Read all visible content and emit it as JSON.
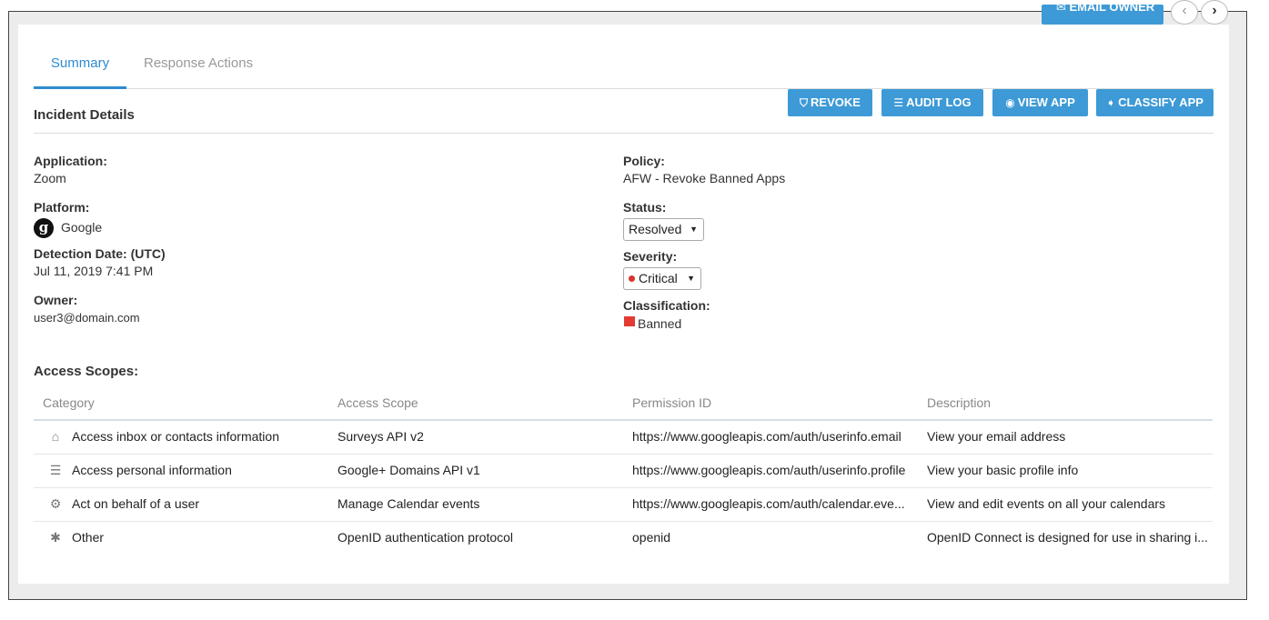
{
  "topbar": {
    "email_owner_label": "EMAIL OWNER",
    "prev_glyph": "‹",
    "next_glyph": "›"
  },
  "tabs": [
    {
      "label": "Summary",
      "active": true
    },
    {
      "label": "Response Actions",
      "active": false
    }
  ],
  "header": {
    "title": "Incident Details",
    "actions": {
      "revoke": {
        "label": "REVOKE",
        "icon": "shield-icon"
      },
      "audit_log": {
        "label": "AUDIT LOG",
        "icon": "list-icon"
      },
      "view_app": {
        "label": "VIEW APP",
        "icon": "eye-icon"
      },
      "classify_app": {
        "label": "CLASSIFY APP",
        "icon": "tag-icon"
      }
    }
  },
  "details": {
    "application_label": "Application:",
    "application_value": "Zoom",
    "platform_label": "Platform:",
    "platform_value": "Google",
    "platform_icon_glyph": "g",
    "detection_label": "Detection Date: (UTC)",
    "detection_value": "Jul 11, 2019 7:41 PM",
    "owner_label": "Owner:",
    "owner_value": "user3@domain.com",
    "policy_label": "Policy:",
    "policy_value": "AFW - Revoke Banned Apps",
    "status_label": "Status:",
    "status_value": "Resolved",
    "severity_label": "Severity:",
    "severity_value": "Critical",
    "severity_color": "#d9342b",
    "classification_label": "Classification:",
    "classification_value": "Banned",
    "classification_color": "#e33b32"
  },
  "access_scopes": {
    "title": "Access Scopes:",
    "columns": [
      "Category",
      "Access Scope",
      "Permission ID",
      "Description"
    ],
    "rows": [
      {
        "icon": "inbox-icon",
        "icon_glyph": "⌂",
        "category": "Access inbox or contacts information",
        "scope": "Surveys API v2",
        "permission": "https://www.googleapis.com/auth/userinfo.email",
        "description": "View your email address"
      },
      {
        "icon": "user-list-icon",
        "icon_glyph": "☰",
        "category": "Access personal information",
        "scope": "Google+ Domains API v1",
        "permission": "https://www.googleapis.com/auth/userinfo.profile",
        "description": "View your basic profile info"
      },
      {
        "icon": "user-gear-icon",
        "icon_glyph": "⚙",
        "category": "Act on behalf of a user",
        "scope": "Manage Calendar events",
        "permission": "https://www.googleapis.com/auth/calendar.eve...",
        "description": "View and edit events on all your calendars"
      },
      {
        "icon": "asterisk-icon",
        "icon_glyph": "✱",
        "category": "Other",
        "scope": "OpenID authentication protocol",
        "permission": "openid",
        "description": "OpenID Connect is designed for use in sharing i..."
      }
    ]
  },
  "colors": {
    "accent": "#3d9ad6",
    "tab_active": "#2e8bd0"
  }
}
